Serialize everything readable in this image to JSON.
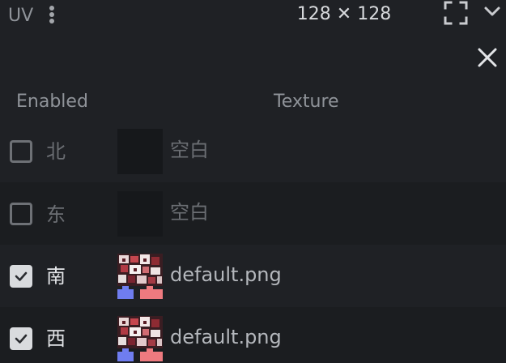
{
  "header": {
    "title": "UV",
    "size_readout": "128 ✕ 128"
  },
  "columns": {
    "enabled": "Enabled",
    "texture": "Texture"
  },
  "faces": [
    {
      "label": "北",
      "enabled": false,
      "texture": "空白"
    },
    {
      "label": "东",
      "enabled": false,
      "texture": "空白"
    },
    {
      "label": "南",
      "enabled": true,
      "texture": "default.png"
    },
    {
      "label": "西",
      "enabled": true,
      "texture": "default.png"
    }
  ],
  "icons": {
    "menu": "vertical-dots-icon",
    "fullscreen": "fullscreen-icon",
    "collapse": "chevron-down-icon",
    "close": "close-icon",
    "check": "checkmark-icon"
  },
  "colors": {
    "background": "#1f2125",
    "row_alt": "#1b1d20",
    "text_dim": "#6b6e73",
    "text_bright": "#e3e5e8"
  }
}
